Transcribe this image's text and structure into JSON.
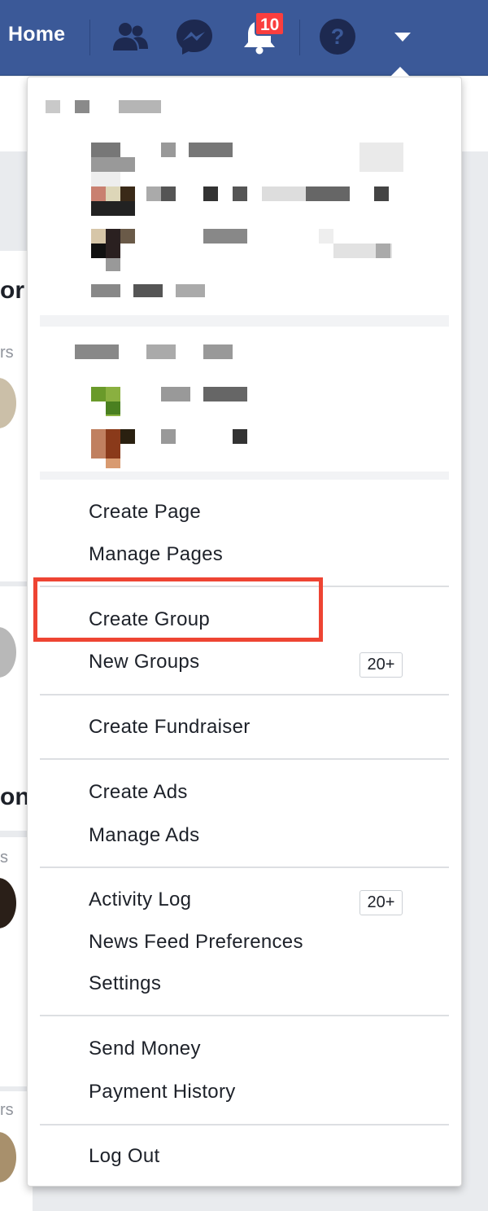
{
  "topbar": {
    "home_label": "Home",
    "notifications_count": "10",
    "icons": [
      "friends-icon",
      "messenger-icon",
      "notifications-icon",
      "help-icon",
      "account-menu-caret-icon"
    ]
  },
  "background": {
    "fragments": [
      "or",
      "rs",
      "on",
      "s",
      "rs"
    ]
  },
  "menu": {
    "pages_section": {
      "create_page": "Create Page",
      "manage_pages": "Manage Pages"
    },
    "groups_section": {
      "create_group": "Create Group",
      "new_groups": "New Groups",
      "new_groups_count": "20+"
    },
    "fundraiser_section": {
      "create_fundraiser": "Create Fundraiser"
    },
    "ads_section": {
      "create_ads": "Create Ads",
      "manage_ads": "Manage Ads"
    },
    "settings_section": {
      "activity_log": "Activity Log",
      "activity_log_count": "20+",
      "news_feed_preferences": "News Feed Preferences",
      "settings": "Settings"
    },
    "payments_section": {
      "send_money": "Send Money",
      "payment_history": "Payment History"
    },
    "logout_section": {
      "log_out": "Log Out"
    }
  },
  "colors": {
    "brand_blue": "#3b5998",
    "badge_red": "#fa3e3e",
    "highlight_red": "#ee4433",
    "text": "#1d2129"
  }
}
